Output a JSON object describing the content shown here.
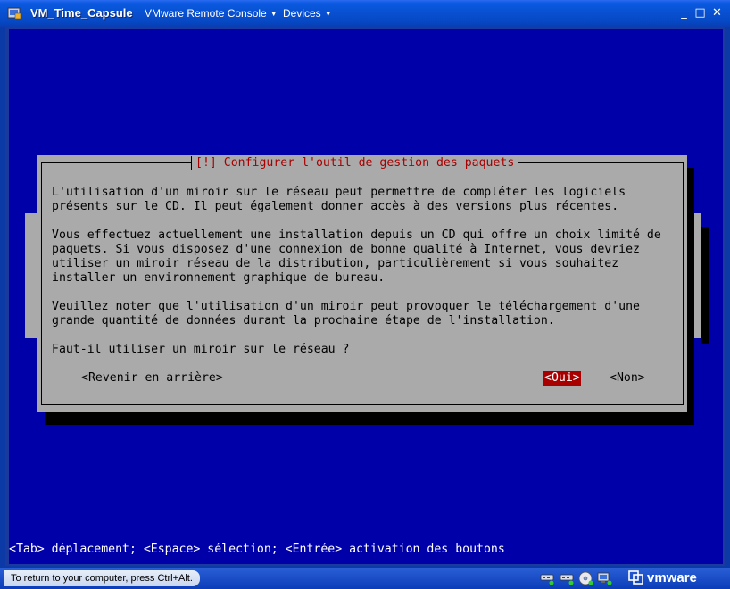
{
  "window": {
    "title": "VM_Time_Capsule",
    "menus": [
      "VMware Remote Console",
      "Devices"
    ],
    "controls": {
      "minimize": "_",
      "maximize": "□",
      "close": "✕"
    }
  },
  "dialog": {
    "title": "[!] Configurer l'outil de gestion des paquets",
    "lines": [
      "L'utilisation d'un miroir sur le réseau peut permettre de compléter les logiciels",
      "présents sur le CD. Il peut également donner accès à des versions plus récentes.",
      "",
      "Vous effectuez actuellement une installation depuis un CD qui offre un choix limité de",
      "paquets. Si vous disposez d'une connexion de bonne qualité à Internet, vous devriez",
      "utiliser un miroir réseau de la distribution, particulièrement si vous souhaitez",
      "installer un environnement graphique de bureau.",
      "",
      "Veuillez noter que l'utilisation d'un miroir peut provoquer le téléchargement d'une",
      "grande quantité de données durant la prochaine étape de l'installation.",
      "",
      "Faut-il utiliser un miroir sur le réseau ?"
    ],
    "buttons": {
      "back": "<Revenir en arrière>",
      "yes": "<Oui>",
      "no": "<Non>"
    }
  },
  "console": {
    "status_line": "<Tab> déplacement; <Espace> sélection; <Entrée> activation des boutons"
  },
  "hostbar": {
    "hint": "To return to your computer, press Ctrl+Alt.",
    "logo": "vmware",
    "device_icons": [
      "network-icon",
      "network-icon",
      "cdrom-icon",
      "display-icon"
    ]
  },
  "colors": {
    "screen_bg": "#0000a8",
    "dialog_bg": "#aaaaaa",
    "dialog_title": "#a80000",
    "selected_button_bg": "#a80000"
  }
}
